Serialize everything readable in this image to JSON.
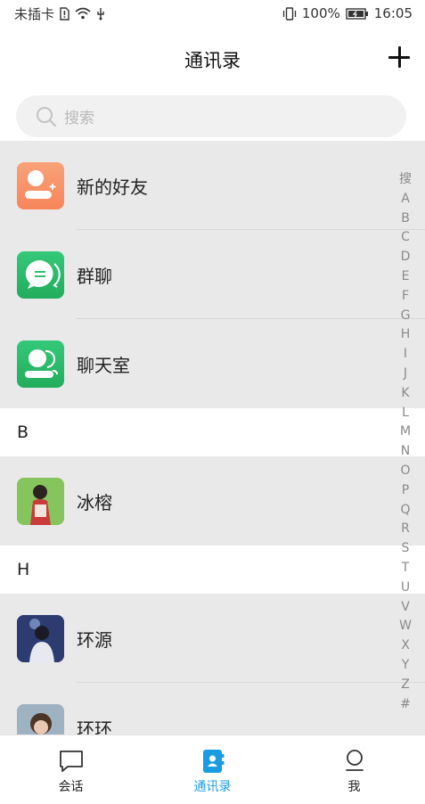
{
  "status_bar": {
    "carrier": "未插卡",
    "battery": "100%",
    "time": "16:05"
  },
  "header": {
    "title": "通讯录",
    "add_icon": "plus-icon"
  },
  "search": {
    "placeholder": "搜索"
  },
  "function_items": [
    {
      "label": "新的好友",
      "icon": "add-friend-icon",
      "color": "#f88a5b"
    },
    {
      "label": "群聊",
      "icon": "group-chat-icon",
      "color": "#2fbf6c"
    },
    {
      "label": "聊天室",
      "icon": "chatroom-icon",
      "color": "#2fbf6c"
    }
  ],
  "sections": [
    {
      "letter": "B",
      "contacts": [
        {
          "name": "冰榕"
        }
      ]
    },
    {
      "letter": "H",
      "contacts": [
        {
          "name": "环源"
        },
        {
          "name": "环环"
        }
      ]
    }
  ],
  "index_letters": [
    "搜",
    "A",
    "B",
    "C",
    "D",
    "E",
    "F",
    "G",
    "H",
    "I",
    "J",
    "K",
    "L",
    "M",
    "N",
    "O",
    "P",
    "Q",
    "R",
    "S",
    "T",
    "U",
    "V",
    "W",
    "X",
    "Y",
    "Z",
    "#"
  ],
  "tabs": [
    {
      "label": "会话",
      "icon": "chat-bubble-icon",
      "active": false
    },
    {
      "label": "通讯录",
      "icon": "contacts-book-icon",
      "active": true
    },
    {
      "label": "我",
      "icon": "profile-icon",
      "active": false
    }
  ],
  "colors": {
    "accent": "#1a9de0",
    "row_bg": "#e9e9e9"
  }
}
